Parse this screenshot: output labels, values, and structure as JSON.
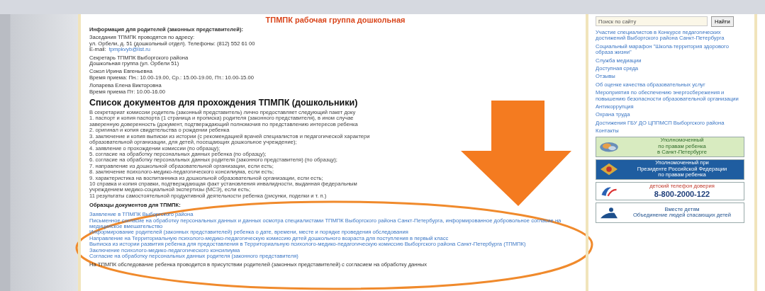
{
  "page_title": "ТПМПК рабочая группа дошкольная",
  "info": [
    {
      "kind": "bold",
      "text": "Информация для родителей (законных представителей):"
    },
    {
      "kind": "group",
      "lines": [
        "Заседания ТПМПК проводятся по адресу:",
        "ул. Орбели, д. 51 (дошкольный отдел). Телефоны: (812) 552 61 00"
      ],
      "email_label": "E-mail:",
      "email": "tpmpkvyb@list.ru"
    },
    {
      "kind": "group",
      "lines": [
        "Секретарь ТПМПК Выборгского района",
        "Дошкольная группа (ул. Орбели 51)"
      ]
    },
    {
      "kind": "group",
      "lines": [
        "Сокол Ирина Евгеньевна",
        "Время приема: Пн.: 10.00-19.00, Ср.: 15.00-19.00, Пт.: 10.00-15.00"
      ]
    },
    {
      "kind": "group",
      "lines": [
        "Лопарева Елена Викторовна",
        "Время приема Пт: 10.00-16.00"
      ]
    }
  ],
  "doc_heading": "Список документов для прохождения ТПМПК (дошкольники)",
  "doc_lines": [
    "В секретариат комиссии родитель (законный представитель) лично предоставляет следующий пакет доку",
    "1. паспорт и копия паспорта (1 страница и прописка) родителя (законного представителя), в ином случае",
    "заверенную доверенность (документ, подтверждающий полномочия по представлению интересов ребенка",
    "2. оригинал и копия свидетельства о рождении ребенка",
    "3. заключение и копия выписки из истории (с рекомендацией врачей специалистов и педагогической характери",
    "образовательной организации, для детей, посещающих дошкольное учреждение);",
    "4. заявление о прохождении комиссии (по образцу);",
    "5. согласие на обработку персональных данных ребенка (по образцу);",
    "6. согласие на обработку персональных данных родителя (законного представителя) (по образцу);",
    "7. направление из дошкольной образовательной организации, если есть;",
    "8. заключение психолого-медико-педагогического консилиума, если есть;",
    "9. характеристика на воспитанника из дошкольной образовательной организации, если есть;",
    "10 справка и копия справки, подтверждающая факт установления инвалидности, выданная федеральным",
    "учреждением медико-социальной экспертизы (МСЭ), если есть;",
    "11 результаты самостоятельной продуктивной деятельности ребенка (рисунки, поделки и т. п.)"
  ],
  "samples_heading": "Образцы документов для ТПМПК:",
  "sample_links": [
    "Заявление в ТПМПК Выборгского района",
    "Письменное согласие на обработку персональных данных и данных осмотра специалистами ТПМПК Выборгского района Санкт-Петербурга, информированное добровольное согласие на медицинское вмешательство",
    "Информирование родителей (законных представителей) ребенка о дате, времени, месте и порядке проведения обследования",
    "Направление на Территориальную психолого-медико-педагогическую комиссию детей дошкольного возраста для поступления в первый класс",
    "Выписка из истории развития ребенка для предоставления в Территориальную психолого-медико-педагогическую комиссию Выборгского района Санкт-Петербурга (ТПМПК)",
    "Заключение психолого-медико-педагогического консилиума",
    "Согласие на обработку персональных данных родителя (законного представителя)"
  ],
  "footer_note": "На ТПМПК обследование ребенка проводится в присутствии родителей (законных представителей) с согласием на обработку данных",
  "search": {
    "placeholder": "Поиск по сайту",
    "button": "Найти"
  },
  "sidebar_links": [
    "Участие специалистов в Конкурсе педагогических достижений Выборгского района Санкт-Петербурга",
    "Социальный марафон \"Школа-территория здорового образа жизни\"",
    "Служба медиации",
    "Доступная среда",
    "Отзывы",
    "Об оценке качества образовательных услуг",
    "Мероприятия по обеспечению энергосбережения и повышению безопасности образовательной организации",
    "Антикоррупция",
    "Охрана труда",
    "Достижения ГБУ ДО ЦППМСП Выборгского района",
    "Контакты"
  ],
  "banners": [
    {
      "kind": "ombudsman-city",
      "lines": [
        "Уполномоченный",
        "по правам ребенка",
        "в Санкт-Петербурге"
      ]
    },
    {
      "kind": "ombudsman-federal",
      "lines": [
        "Уполномоченный при",
        "Президенте Российской Федерации",
        "по правам ребенка"
      ]
    },
    {
      "kind": "helpline",
      "lines": [
        "детский телефон доверия",
        "8-800-2000-122"
      ]
    },
    {
      "kind": "people",
      "lines": [
        "Вместе детям",
        "Объединение людей спасающих детей"
      ]
    }
  ]
}
